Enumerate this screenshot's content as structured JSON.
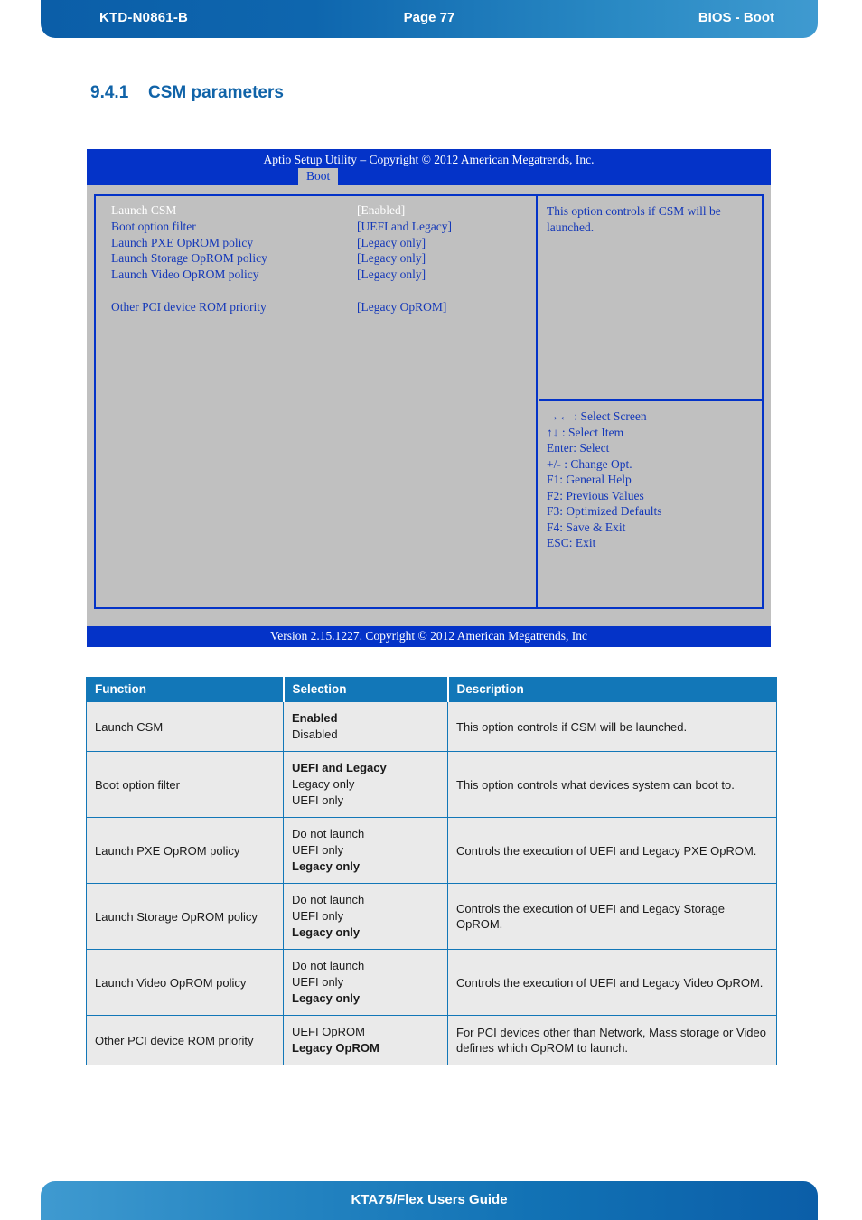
{
  "page_header": {
    "left": "KTD-N0861-B",
    "center": "Page 77",
    "right": "BIOS  - Boot"
  },
  "section": {
    "number": "9.4.1",
    "title": "CSM parameters"
  },
  "bios_screen": {
    "title": "Aptio Setup Utility  –  Copyright © 2012 American Megatrends, Inc.",
    "active_tab": "Boot",
    "options": [
      {
        "name": "Launch CSM",
        "value": "[Enabled]",
        "highlighted": true
      },
      {
        "name": "Boot option filter",
        "value": "[UEFI and Legacy]",
        "highlighted": false
      },
      {
        "name": "Launch PXE OpROM policy",
        "value": "[Legacy only]",
        "highlighted": false
      },
      {
        "name": "Launch Storage OpROM policy",
        "value": "[Legacy only]",
        "highlighted": false
      },
      {
        "name": "Launch Video OpROM policy",
        "value": "[Legacy only]",
        "highlighted": false
      },
      {
        "name": "",
        "value": "",
        "highlighted": false
      },
      {
        "name": "Other PCI device ROM priority",
        "value": "[Legacy OpROM]",
        "highlighted": false
      }
    ],
    "help_text": "This option controls if CSM will be launched.",
    "key_help": [
      "→←  : Select Screen",
      "↑↓ : Select Item",
      "Enter: Select",
      "+/- : Change Opt.",
      "F1: General Help",
      "F2: Previous Values",
      "F3: Optimized Defaults",
      "F4: Save & Exit",
      "ESC: Exit"
    ],
    "version_footer": "Version 2.15.1227. Copyright © 2012 American Megatrends, Inc"
  },
  "table": {
    "headers": [
      "Function",
      "Selection",
      "Description"
    ],
    "rows": [
      {
        "function": "Launch CSM",
        "selection": [
          {
            "text": "Enabled",
            "bold": true
          },
          {
            "text": "Disabled",
            "bold": false
          }
        ],
        "description": "This option controls if CSM will be launched."
      },
      {
        "function": "Boot option filter",
        "selection": [
          {
            "text": "UEFI and Legacy",
            "bold": true
          },
          {
            "text": "Legacy only",
            "bold": false
          },
          {
            "text": "UEFI only",
            "bold": false
          }
        ],
        "description": "This option controls what devices system can boot to."
      },
      {
        "function": "Launch PXE OpROM policy",
        "selection": [
          {
            "text": "Do not launch",
            "bold": false
          },
          {
            "text": "UEFI only",
            "bold": false
          },
          {
            "text": "Legacy only",
            "bold": true
          }
        ],
        "description": "Controls the execution of UEFI and Legacy PXE OpROM."
      },
      {
        "function": "Launch Storage OpROM policy",
        "selection": [
          {
            "text": "Do not launch",
            "bold": false
          },
          {
            "text": "UEFI only",
            "bold": false
          },
          {
            "text": "Legacy only",
            "bold": true
          }
        ],
        "description": "Controls the execution of UEFI and Legacy Storage OpROM."
      },
      {
        "function": "Launch Video OpROM policy",
        "selection": [
          {
            "text": "Do not launch",
            "bold": false
          },
          {
            "text": "UEFI only",
            "bold": false
          },
          {
            "text": "Legacy only",
            "bold": true
          }
        ],
        "description": "Controls the execution of UEFI and Legacy Video OpROM."
      },
      {
        "function": "Other PCI device ROM priority",
        "selection": [
          {
            "text": "UEFI OpROM",
            "bold": false
          },
          {
            "text": "Legacy OpROM",
            "bold": true
          }
        ],
        "description": "For PCI devices other than Network, Mass storage or Video defines which OpROM to launch."
      }
    ]
  },
  "page_footer": {
    "center": "KTA75/Flex Users Guide"
  },
  "colors": {
    "brand_blue": "#1063a8",
    "table_header": "#1277b8",
    "bios_blue": "#0433c8",
    "bios_gray": "#c0c0c0"
  }
}
